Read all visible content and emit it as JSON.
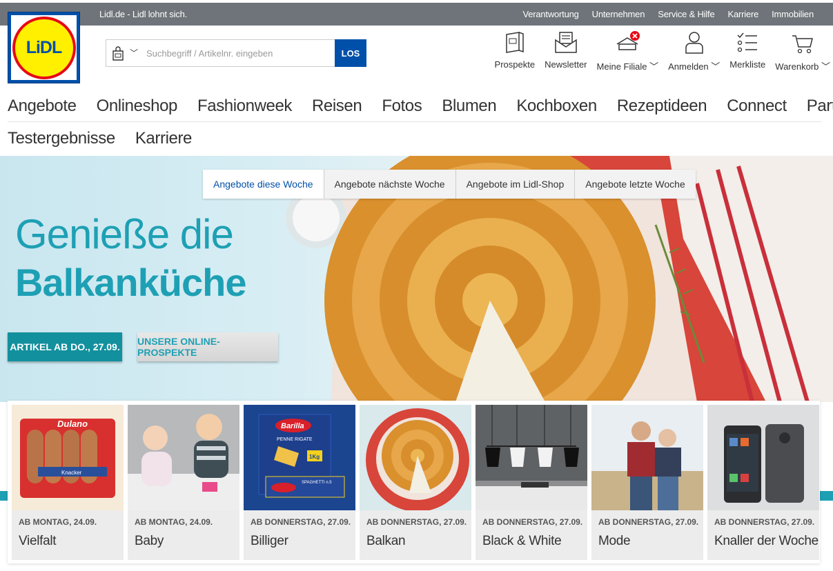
{
  "topbar": {
    "tagline": "Lidl.de - Lidl lohnt sich.",
    "links": [
      "Verantwortung",
      "Unternehmen",
      "Service & Hilfe",
      "Karriere",
      "Immobilien"
    ]
  },
  "logo": {
    "text": "LiDL"
  },
  "search": {
    "placeholder": "Suchbegriff / Artikelnr. eingeben",
    "value": "",
    "button": "LOS"
  },
  "header_icons": [
    {
      "label": "Prospekte",
      "icon": "brochure-icon"
    },
    {
      "label": "Newsletter",
      "icon": "newsletter-icon"
    },
    {
      "label": "Meine Filiale ﹀",
      "icon": "store-icon"
    },
    {
      "label": "Anmelden ﹀",
      "icon": "user-icon"
    },
    {
      "label": "Merkliste",
      "icon": "checklist-icon"
    },
    {
      "label": "Warenkorb ﹀",
      "icon": "cart-icon"
    }
  ],
  "nav": {
    "row1": [
      "Angebote",
      "Onlineshop",
      "Fashionweek",
      "Reisen",
      "Fotos",
      "Blumen",
      "Kochboxen",
      "Rezeptideen",
      "Connect",
      "Partneraktionen"
    ],
    "row2": [
      "Testergebnisse",
      "Karriere"
    ]
  },
  "hero": {
    "tabs": [
      "Angebote diese Woche",
      "Angebote nächste Woche",
      "Angebote im Lidl-Shop",
      "Angebote letzte Woche"
    ],
    "active_tab": 0,
    "headline_line1": "Genieße die",
    "headline_line2": "Balkanküche",
    "primary_button": "ARTIKEL AB DO., 27.09.",
    "secondary_button": "UNSERE ONLINE-PROSPEKTE"
  },
  "categories": [
    {
      "date": "AB MONTAG, 24.09.",
      "title": "Vielfalt",
      "img": "sausage-pack"
    },
    {
      "date": "AB MONTAG, 24.09.",
      "title": "Baby",
      "img": "babies"
    },
    {
      "date": "AB DONNERSTAG, 27.09.",
      "title": "Billiger",
      "img": "pasta-packs"
    },
    {
      "date": "AB DONNERSTAG, 27.09.",
      "title": "Balkan",
      "img": "pie"
    },
    {
      "date": "AB DONNERSTAG, 27.09.",
      "title": "Black & White",
      "img": "lamps"
    },
    {
      "date": "AB DONNERSTAG, 27.09.",
      "title": "Mode",
      "img": "couple"
    },
    {
      "date": "AB DONNERSTAG, 27.09.",
      "title": "Knaller der Woche",
      "img": "smartphone"
    }
  ],
  "product_text": {
    "dulano": "Dulano",
    "knacker": "Knacker",
    "barilla": "Barilla",
    "penne": "PENNE RIGATE",
    "spaghetti": "SPAGHETTI n.5",
    "kg": "1Kg"
  },
  "colors": {
    "lidl_blue": "#0050aa",
    "lidl_yellow": "#fff000",
    "lidl_red": "#e60a14",
    "teal": "#1ea0b4",
    "topbar_gray": "#6e7479"
  }
}
